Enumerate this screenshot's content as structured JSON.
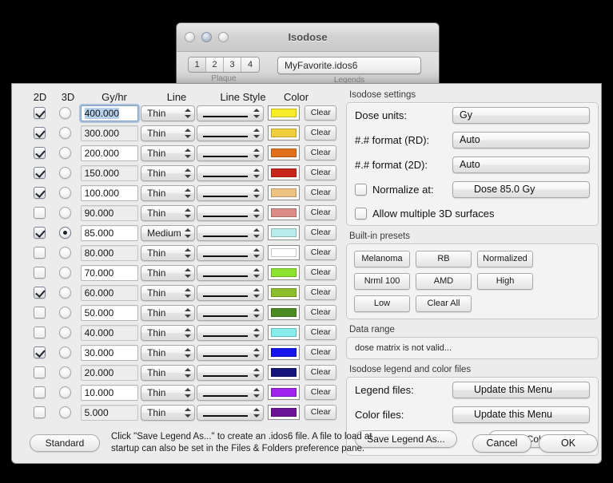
{
  "parent_window": {
    "title": "Isodose",
    "traffic_lights": [
      "close-button",
      "minimize-button",
      "zoom-button"
    ],
    "plaque": {
      "label": "Plaque",
      "segments": [
        "1",
        "2",
        "3",
        "4"
      ],
      "selected": "1"
    },
    "legends": {
      "label": "Legends",
      "value": "MyFavorite.idos6"
    }
  },
  "table": {
    "headers": {
      "col_2d": "2D",
      "col_3d": "3D",
      "col_value": "Gy/hr",
      "col_line": "Line",
      "col_line_style": "Line Style",
      "col_color": "Color"
    },
    "clear_label": "Clear",
    "rows": [
      {
        "enabled_2d": true,
        "enabled_3d": false,
        "value": "400.000",
        "line": "Thin",
        "color": "#f7ec2a",
        "focused": true
      },
      {
        "enabled_2d": true,
        "enabled_3d": false,
        "value": "300.000",
        "line": "Thin",
        "color": "#f0cd3b",
        "focused": false
      },
      {
        "enabled_2d": true,
        "enabled_3d": false,
        "value": "200.000",
        "line": "Thin",
        "color": "#e2711d",
        "focused": false
      },
      {
        "enabled_2d": true,
        "enabled_3d": false,
        "value": "150.000",
        "line": "Thin",
        "color": "#c9261b",
        "focused": false
      },
      {
        "enabled_2d": true,
        "enabled_3d": false,
        "value": "100.000",
        "line": "Thin",
        "color": "#eec283",
        "focused": false
      },
      {
        "enabled_2d": false,
        "enabled_3d": false,
        "value": "90.000",
        "line": "Thin",
        "color": "#d98d85",
        "focused": false
      },
      {
        "enabled_2d": true,
        "enabled_3d": true,
        "value": "85.000",
        "line": "Medium",
        "color": "#b6ecea",
        "focused": false
      },
      {
        "enabled_2d": false,
        "enabled_3d": false,
        "value": "80.000",
        "line": "Thin",
        "color": "#79ccа1",
        "focused": false
      },
      {
        "enabled_2d": false,
        "enabled_3d": false,
        "value": "70.000",
        "line": "Thin",
        "color": "#8de22e",
        "focused": false
      },
      {
        "enabled_2d": true,
        "enabled_3d": false,
        "value": "60.000",
        "line": "Thin",
        "color": "#8cbe2c",
        "focused": false
      },
      {
        "enabled_2d": false,
        "enabled_3d": false,
        "value": "50.000",
        "line": "Thin",
        "color": "#4c8b22",
        "focused": false
      },
      {
        "enabled_2d": false,
        "enabled_3d": false,
        "value": "40.000",
        "line": "Thin",
        "color": "#87ecec",
        "focused": false
      },
      {
        "enabled_2d": true,
        "enabled_3d": false,
        "value": "30.000",
        "line": "Thin",
        "color": "#1616ec",
        "focused": false
      },
      {
        "enabled_2d": false,
        "enabled_3d": false,
        "value": "20.000",
        "line": "Thin",
        "color": "#16167a",
        "focused": false
      },
      {
        "enabled_2d": false,
        "enabled_3d": false,
        "value": "10.000",
        "line": "Thin",
        "color": "#9e23ed",
        "focused": false
      },
      {
        "enabled_2d": false,
        "enabled_3d": false,
        "value": "5.000",
        "line": "Thin",
        "color": "#6d1397",
        "focused": false
      }
    ]
  },
  "settings": {
    "group_title": "Isodose settings",
    "dose_units": {
      "label": "Dose units:",
      "value": "Gy"
    },
    "format_rd": {
      "label": "#.# format (RD):",
      "value": "Auto"
    },
    "format_2d": {
      "label": "#.# format (2D):",
      "value": "Auto"
    },
    "normalize": {
      "label": "Normalize at:",
      "checked": false,
      "value": "Dose 85.0 Gy",
      "icon": "rx-icon"
    },
    "allow_multi_3d": {
      "label": "Allow multiple 3D surfaces",
      "checked": false
    }
  },
  "presets": {
    "group_title": "Built-in presets",
    "buttons": [
      "Melanoma",
      "RB",
      "Normalized",
      "Nrml 100",
      "AMD",
      "High",
      "Low",
      "Clear All"
    ]
  },
  "data_range": {
    "group_title": "Data range",
    "message": "dose matrix is not valid..."
  },
  "files": {
    "group_title": "Isodose legend and color files",
    "legend_files": {
      "label": "Legend files:",
      "value": "Update this Menu"
    },
    "color_files": {
      "label": "Color files:",
      "value": "Update this Menu"
    },
    "save_legend": "Save Legend As...",
    "save_colors": "Save Colors As..."
  },
  "footer": {
    "standard": "Standard",
    "help_line1": "Click \"Save Legend As...\" to create an .idos6 file. A file to load at",
    "help_line2": "startup can also be set in the Files & Folders preference pane.",
    "cancel": "Cancel",
    "ok": "OK"
  }
}
